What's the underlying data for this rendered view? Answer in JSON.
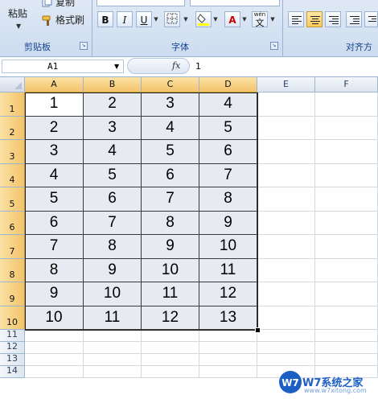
{
  "ribbon": {
    "clipboard": {
      "paste_label": "粘贴",
      "copy_label": "复制",
      "format_painter_label": "格式刷",
      "group_label": "剪贴板"
    },
    "font": {
      "bold": "B",
      "italic": "I",
      "underline": "U",
      "font_color_glyph": "A",
      "wen_glyph": "文",
      "wen_sup": "wén",
      "group_label": "字体"
    },
    "alignment": {
      "group_label": "对齐方"
    }
  },
  "formula_bar": {
    "name_box": "A1",
    "fx_label": "fx",
    "formula": "1"
  },
  "sheet": {
    "columns": [
      "A",
      "B",
      "C",
      "D",
      "E",
      "F"
    ],
    "rows": [
      "1",
      "2",
      "3",
      "4",
      "5",
      "6",
      "7",
      "8",
      "9",
      "10",
      "11",
      "12",
      "13",
      "14"
    ],
    "data": [
      [
        "1",
        "2",
        "3",
        "4"
      ],
      [
        "2",
        "3",
        "4",
        "5"
      ],
      [
        "3",
        "4",
        "5",
        "6"
      ],
      [
        "4",
        "5",
        "6",
        "7"
      ],
      [
        "5",
        "6",
        "7",
        "8"
      ],
      [
        "6",
        "7",
        "8",
        "9"
      ],
      [
        "7",
        "8",
        "9",
        "10"
      ],
      [
        "8",
        "9",
        "10",
        "11"
      ],
      [
        "9",
        "10",
        "11",
        "12"
      ],
      [
        "10",
        "11",
        "12",
        "13"
      ]
    ],
    "selection": "A1:D10",
    "active_cell": "A1"
  },
  "watermark": {
    "text": "W7系统之家",
    "url": "www.w7xitong.com"
  },
  "colors": {
    "selection_fill": "#e8eaf2",
    "header_selected": "#f3c369",
    "ribbon_bg": "#dfe9f5",
    "watermark_blue": "#1b5fc4"
  }
}
